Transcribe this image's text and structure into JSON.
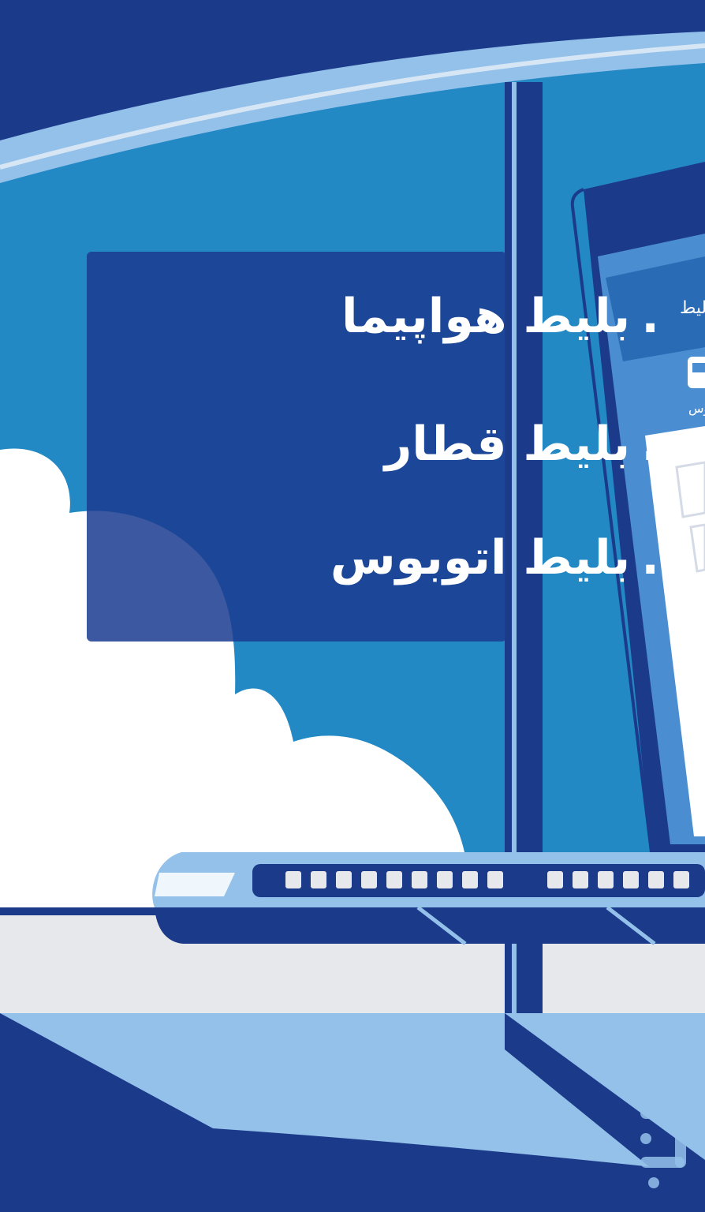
{
  "features": [
    {
      "bullet": ".",
      "label": "بلیط هواپیما"
    },
    {
      "bullet": ".",
      "label": "بلیط قطار"
    },
    {
      "bullet": ".",
      "label": "بلیط اتوبوس"
    }
  ],
  "phone_preview": {
    "header_fragment": "لیط",
    "tab_fragment": "وس"
  },
  "icons": {
    "bus": "bus-icon",
    "store_logo": "store-logo-icon"
  },
  "colors": {
    "navy": "#1c3a8a",
    "sky": "#2289c4",
    "light_blue": "#94c1ea",
    "cloud": "#ffffff",
    "ground": "#e7e8ec"
  }
}
